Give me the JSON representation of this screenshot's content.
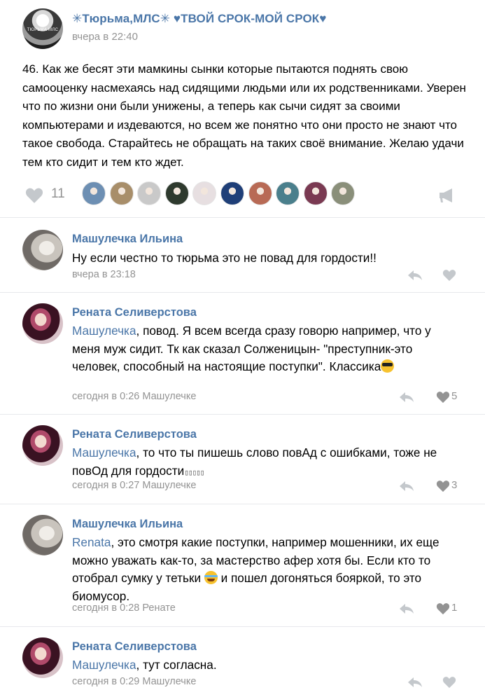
{
  "post": {
    "group_name": "✳Тюрьма,МЛС✳ ♥ТВОЙ СРОК-МОЙ СРОК♥",
    "avatar_text": "ТЮРЬМА МЛС",
    "time": "вчера в 22:40",
    "text": "46. Как же бесят эти мамкины сынки которые пытаются поднять свою самооценку насмехаясь над сидящими людьми или их родственниками. Уверен что по жизни они были унижены, а теперь как сычи сидят за своими компьютерами и издеваются, но всем же понятно что они просто не знают что такое свобода. Старайтесь не обращать на таких своё внимание. Желаю удачи тем кто сидит и тем кто ждет.",
    "likes": "11",
    "liker_colors": [
      "#6d8fb3",
      "#a88e6a",
      "#c9c9c9",
      "#2e3a2e",
      "#e7dfe1",
      "#1f3f78",
      "#b86a55",
      "#4a7f8c",
      "#7a3a52",
      "#8a8f7a"
    ]
  },
  "icons": {
    "like": "heart-icon",
    "share": "megaphone-icon",
    "reply": "reply-arrow-icon"
  },
  "colors": {
    "link": "#4a76a8",
    "meta": "#939393",
    "icon": "#c4c8cc"
  },
  "comments": [
    {
      "author": "Машулечка Ильина",
      "mention": "",
      "text": "Ну если честно то тюрьма это не повад для гордости!!",
      "meta": "вчера в 23:18",
      "likes": ""
    },
    {
      "author": "Рената Селиверстова",
      "mention": "Машулечка",
      "text": ", повод. Я всем всегда сразу говорю например, что у меня муж сидит. Тк как сказал Солженицын- \"преступник-это человек, способный на настоящие поступки\". Классика",
      "meta": "сегодня в 0:26 Машулечке",
      "likes": "5"
    },
    {
      "author": "Рената Селиверстова",
      "mention": "Машулечка",
      "text": ", то что ты пишешь слово повАд с ошибками, тоже не повОд для гордости",
      "boxes": "▯▯▯▯▯",
      "meta": "сегодня в 0:27 Машулечке",
      "likes": "3"
    },
    {
      "author": "Машулечка Ильина",
      "mention": "Renata",
      "text": ", это смотря какие поступки, например мошенники, их еще можно уважать как-то, за мастерство афер хотя бы. Если кто то отобрал сумку у тетьки",
      "text_after": " и пошел догоняться бояркой, то это биомусор.",
      "meta": "сегодня в 0:28 Ренате",
      "likes": "1"
    },
    {
      "author": "Рената Селиверстова",
      "mention": "Машулечка",
      "text": ", тут согласна.",
      "meta": "сегодня в 0:29 Машулечке",
      "likes": ""
    }
  ]
}
